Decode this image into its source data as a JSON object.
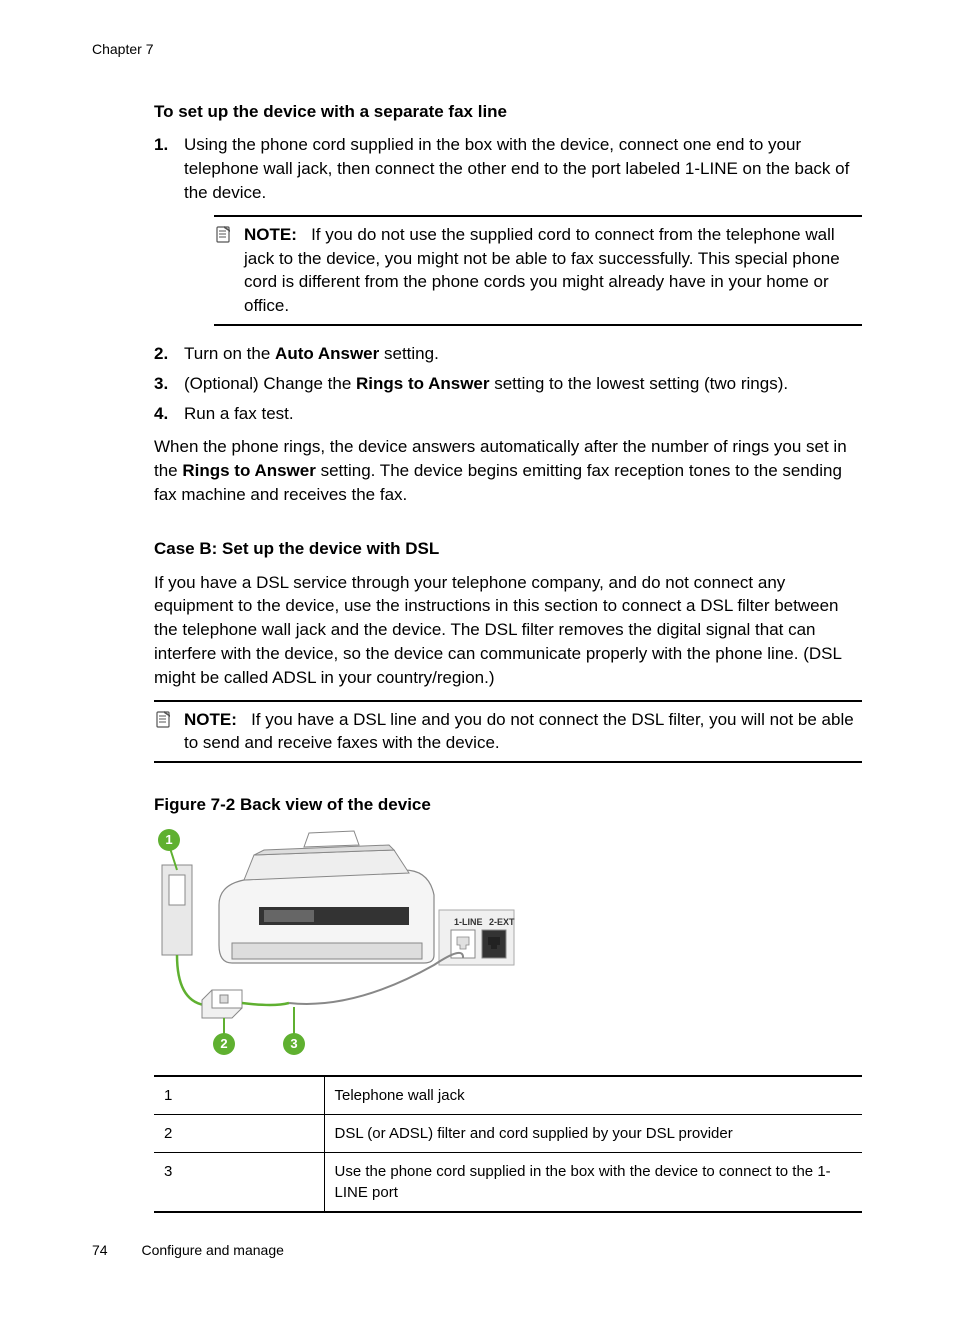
{
  "chapter": "Chapter 7",
  "heading1": "To set up the device with a separate fax line",
  "step1_num": "1.",
  "step1_text": "Using the phone cord supplied in the box with the device, connect one end to your telephone wall jack, then connect the other end to the port labeled 1-LINE on the back of the device.",
  "note1_label": "NOTE:",
  "note1_text": "If you do not use the supplied cord to connect from the telephone wall jack to the device, you might not be able to fax successfully. This special phone cord is different from the phone cords you might already have in your home or office.",
  "step2_num": "2.",
  "step2_prefix": "Turn on the ",
  "step2_bold": "Auto Answer",
  "step2_suffix": " setting.",
  "step3_num": "3.",
  "step3_prefix": "(Optional) Change the ",
  "step3_bold": "Rings to Answer",
  "step3_suffix": " setting to the lowest setting (two rings).",
  "step4_num": "4.",
  "step4_text": "Run a fax test.",
  "para1_prefix": "When the phone rings, the device answers automatically after the number of rings you set in the ",
  "para1_bold": "Rings to Answer",
  "para1_suffix": " setting. The device begins emitting fax reception tones to the sending fax machine and receives the fax.",
  "heading2": "Case B: Set up the device with DSL",
  "para2": "If you have a DSL service through your telephone company, and do not connect any equipment to the device, use the instructions in this section to connect a DSL filter between the telephone wall jack and the device. The DSL filter removes the digital signal that can interfere with the device, so the device can communicate properly with the phone line. (DSL might be called ADSL in your country/region.)",
  "note2_label": "NOTE:",
  "note2_text": "If you have a DSL line and you do not connect the DSL filter, you will not be able to send and receive faxes with the device.",
  "figure_caption": "Figure 7-2 Back view of the device",
  "port_label1": "1-LINE",
  "port_label2": "2-EXT",
  "callout1": "1",
  "callout2": "2",
  "callout3": "3",
  "legend": [
    {
      "num": "1",
      "text": "Telephone wall jack"
    },
    {
      "num": "2",
      "text": "DSL (or ADSL) filter and cord supplied by your DSL provider"
    },
    {
      "num": "3",
      "text": "Use the phone cord supplied in the box with the device to connect to the 1-LINE port"
    }
  ],
  "page_number": "74",
  "footer_text": "Configure and manage"
}
